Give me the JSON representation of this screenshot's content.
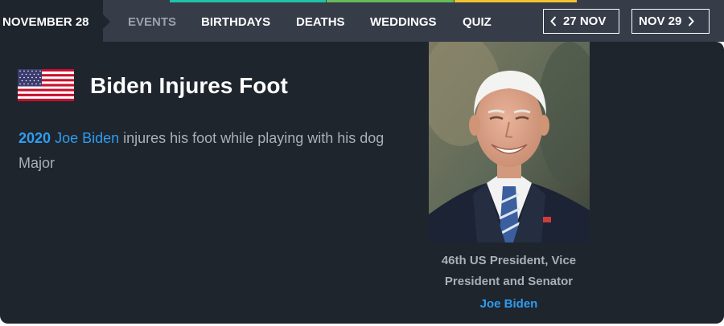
{
  "nav": {
    "date_label": "NOVEMBER 28",
    "links": [
      {
        "label": "EVENTS",
        "active": true
      },
      {
        "label": "BIRTHDAYS",
        "active": false
      },
      {
        "label": "DEATHS",
        "active": false
      },
      {
        "label": "WEDDINGS",
        "active": false
      },
      {
        "label": "QUIZ",
        "active": false
      }
    ],
    "prev_label": "27 NOV",
    "next_label": "NOV 29",
    "accent_colors": [
      "#1fc3a9",
      "#66bb5a",
      "#f2c230"
    ]
  },
  "event": {
    "flag_icon": "us-flag-icon",
    "title": "Biden Injures Foot",
    "year": "2020",
    "person_link": "Joe Biden",
    "text": " injures his foot while playing with his dog Major"
  },
  "profile": {
    "photo_icon": "portrait-photo",
    "caption": "46th US President, Vice President and Senator",
    "name_link": "Joe Biden"
  },
  "colors": {
    "nav_bg": "#363c48",
    "card_bg": "#1f252d",
    "link_blue": "#2e9cf0",
    "muted_text": "#a9b0b9"
  }
}
